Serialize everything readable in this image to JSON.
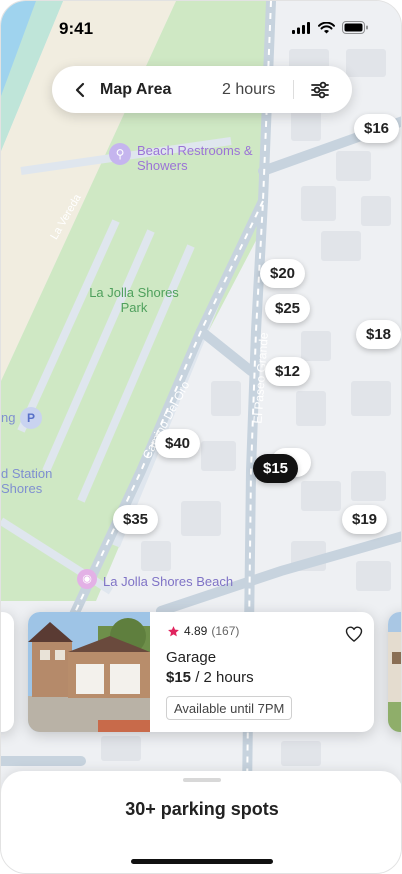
{
  "status_bar": {
    "time": "9:41",
    "icons": [
      "cellular-signal-icon",
      "wifi-icon",
      "battery-icon"
    ]
  },
  "search": {
    "back_icon": "chevron-left-icon",
    "title": "Map Area",
    "duration": "2 hours",
    "filter_icon": "sliders-icon"
  },
  "map": {
    "labels": {
      "park": "La Jolla Shores Park",
      "restrooms": "Beach Restrooms & Showers",
      "beach": "La Jolla Shores Beach",
      "street_el_paseo": "El Paseo Grande",
      "street_camino": "Camino Del Oro",
      "street_vallecitos": "La Vereda",
      "station_partial_1": "d Station",
      "station_partial_2": "Shores",
      "parking_partial": "ng"
    },
    "markers": [
      {
        "price": "$16",
        "selected": false
      },
      {
        "price": "$20",
        "selected": false
      },
      {
        "price": "$25",
        "selected": false
      },
      {
        "price": "$18",
        "selected": false
      },
      {
        "price": "$12",
        "selected": false
      },
      {
        "price": "$40",
        "selected": false
      },
      {
        "price": "$15",
        "selected": true
      },
      {
        "price": "$35",
        "selected": false
      },
      {
        "price": "$19",
        "selected": false
      }
    ]
  },
  "listing": {
    "rating": "4.89",
    "review_count": "(167)",
    "type": "Garage",
    "price": "$15",
    "price_suffix": "/ 2 hours",
    "availability": "Available until 7PM",
    "favorite_icon": "heart-outline-icon",
    "star_icon": "star-icon"
  },
  "sheet": {
    "title": "30+ parking spots"
  },
  "colors": {
    "accent_star": "#e0245e",
    "park_green": "#cfe8c4",
    "water_blue": "#9fd3ee",
    "road": "#c7d3de",
    "selected_marker": "#111111"
  }
}
